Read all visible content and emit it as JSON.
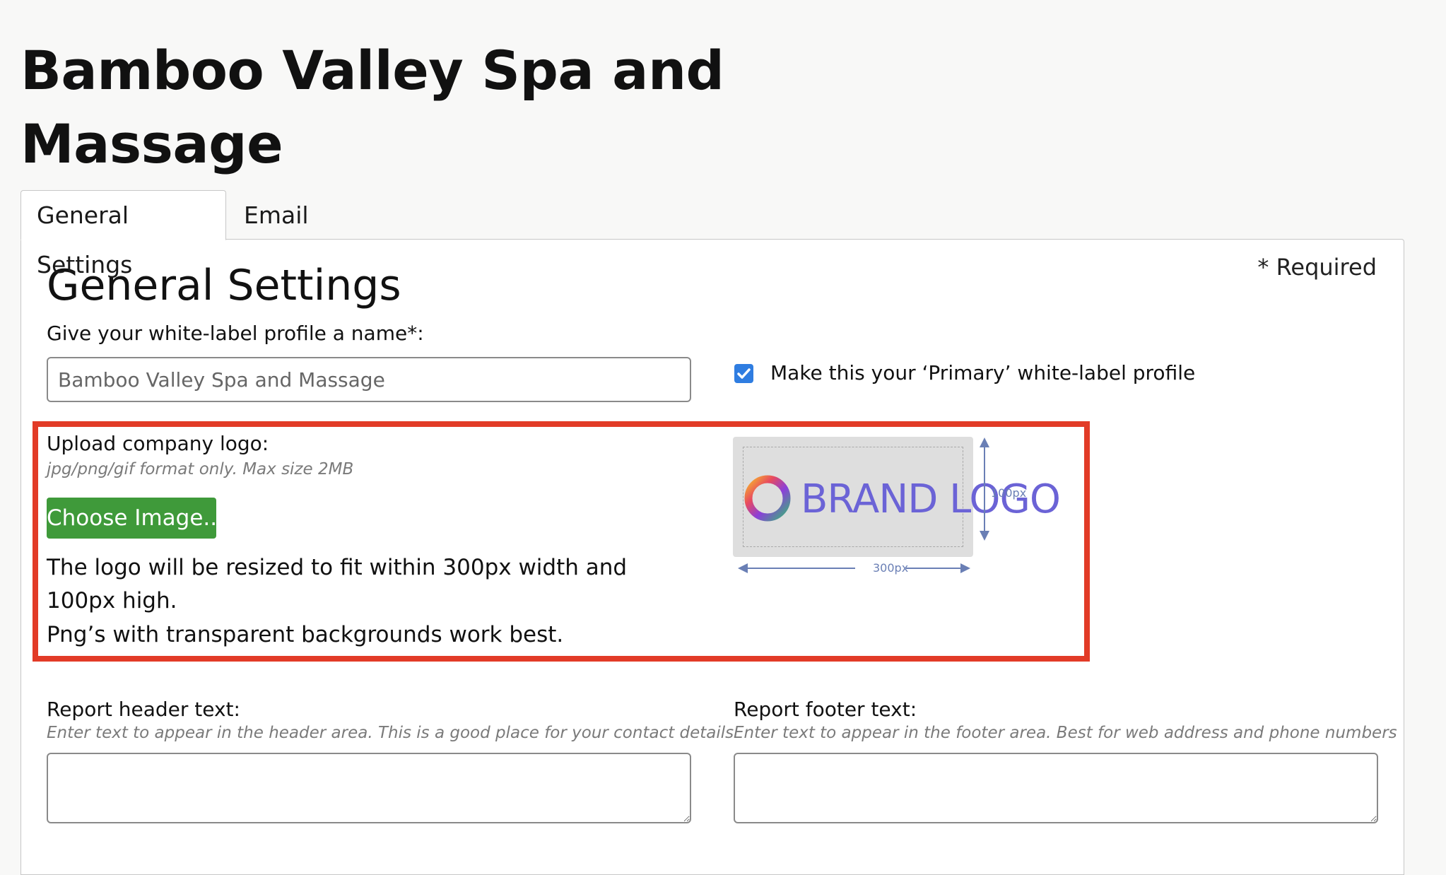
{
  "page": {
    "title": "Bamboo Valley Spa and Massage"
  },
  "tabs": [
    {
      "label": "General Settings",
      "active": true
    },
    {
      "label": "Email Settings",
      "active": false
    }
  ],
  "panel": {
    "section_title": "General Settings",
    "required_note": "* Required",
    "profile_name": {
      "label": "Give your white-label profile a name*:",
      "value": "Bamboo Valley Spa and Massage"
    },
    "primary_checkbox": {
      "label": "Make this your ‘Primary’ white-label profile",
      "checked": true
    },
    "logo_upload": {
      "label": "Upload company logo:",
      "hint": "jpg/png/gif format only. Max size 2MB",
      "button_label": "Choose Image...",
      "resize_note": "The logo will be resized to fit within 300px width and 100px high.",
      "png_note": "Png’s with transparent backgrounds work best.",
      "preview_text": "BRAND LOGO",
      "height_label": "100px",
      "width_label": "300px"
    },
    "report_header": {
      "label": "Report header text:",
      "hint": "Enter text to appear in the header area. This is a good place for your contact details",
      "value": ""
    },
    "report_footer": {
      "label": "Report footer text:",
      "hint": "Enter text to appear in the footer area. Best for web address and phone numbers",
      "value": ""
    }
  },
  "colors": {
    "highlight_border": "#e23b27",
    "choose_button": "#3f9a3a",
    "checkbox": "#2f7de1",
    "brand_logo_text": "#6b63d6",
    "dimension_lines": "#6a7fb5"
  }
}
